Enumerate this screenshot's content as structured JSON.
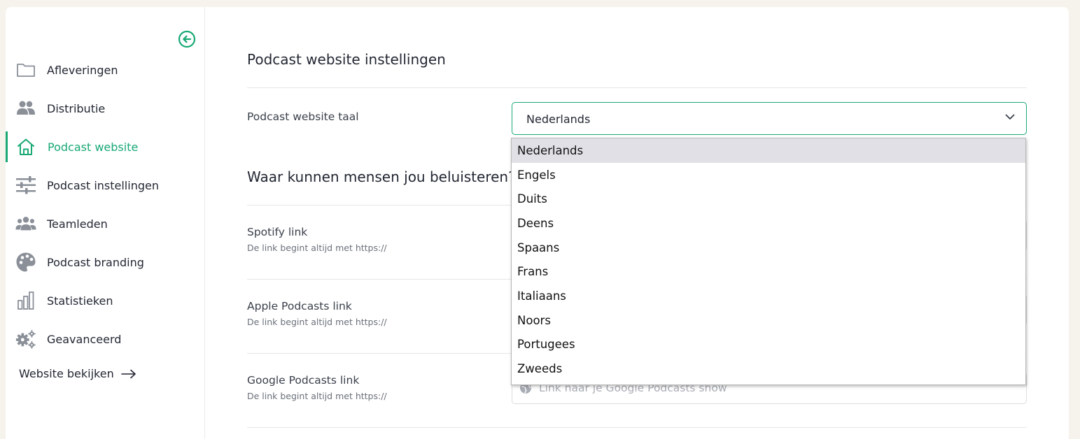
{
  "sidebar": {
    "collapse_icon": "arrow-left-circle-icon",
    "items": [
      {
        "label": "Afleveringen",
        "icon": "folder-icon",
        "active": false
      },
      {
        "label": "Distributie",
        "icon": "users-icon",
        "active": false
      },
      {
        "label": "Podcast website",
        "icon": "home-icon",
        "active": true
      },
      {
        "label": "Podcast instellingen",
        "icon": "sliders-icon",
        "active": false
      },
      {
        "label": "Teamleden",
        "icon": "team-icon",
        "active": false
      },
      {
        "label": "Podcast branding",
        "icon": "palette-icon",
        "active": false
      },
      {
        "label": "Statistieken",
        "icon": "bar-chart-icon",
        "active": false
      },
      {
        "label": "Geavanceerd",
        "icon": "gears-icon",
        "active": false
      }
    ],
    "website_link": "Website bekijken"
  },
  "main": {
    "section1_title": "Podcast website instellingen",
    "language_label": "Podcast website taal",
    "language_value": "Nederlands",
    "section2_title": "Waar kunnen mensen jou beluisteren?",
    "links": [
      {
        "label": "Spotify link",
        "hint": "De link begint altijd met https://",
        "placeholder": ""
      },
      {
        "label": "Apple Podcasts link",
        "hint": "De link begint altijd met https://",
        "placeholder": ""
      },
      {
        "label": "Google Podcasts link",
        "hint": "De link begint altijd met https://",
        "placeholder": "Link naar je Google Podcasts show"
      }
    ]
  },
  "dropdown": {
    "options": [
      "Nederlands",
      "Engels",
      "Duits",
      "Deens",
      "Spaans",
      "Frans",
      "Italiaans",
      "Noors",
      "Portugees",
      "Zweeds"
    ],
    "selected": "Nederlands"
  },
  "colors": {
    "accent": "#19a974",
    "background": "#f6f3ec",
    "text": "#232733",
    "icon_gray": "#8a8f98"
  }
}
